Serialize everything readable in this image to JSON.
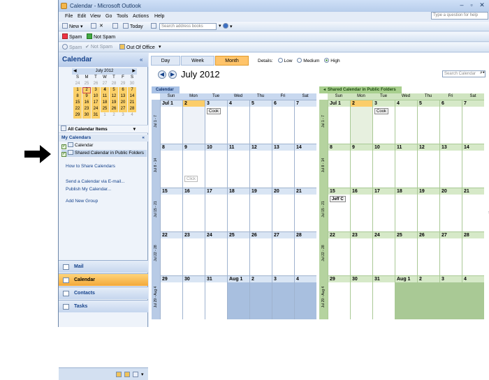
{
  "window": {
    "title": "Calendar - Microsoft Outlook"
  },
  "menu": [
    "File",
    "Edit",
    "View",
    "Go",
    "Tools",
    "Actions",
    "Help"
  ],
  "help_placeholder": "Type a question for help",
  "toolbar1": {
    "new": "New",
    "today": "Today",
    "address_placeholder": "Search address books"
  },
  "toolbar2": {
    "spam": "Spam",
    "not_spam": "Not Spam"
  },
  "toolbar3": {
    "spam": "Spam",
    "not_spam": "Not Spam",
    "out_of_office": "Out Of Office"
  },
  "nav": {
    "title": "Calendar",
    "mini_cal": {
      "month_label": "July 2012",
      "day_headers": [
        "S",
        "M",
        "T",
        "W",
        "T",
        "F",
        "S"
      ],
      "weeks": [
        [
          "24",
          "25",
          "26",
          "27",
          "28",
          "29",
          "30"
        ],
        [
          "1",
          "2",
          "3",
          "4",
          "5",
          "6",
          "7"
        ],
        [
          "8",
          "9",
          "10",
          "11",
          "12",
          "13",
          "14"
        ],
        [
          "15",
          "16",
          "17",
          "18",
          "19",
          "20",
          "21"
        ],
        [
          "22",
          "23",
          "24",
          "25",
          "26",
          "27",
          "28"
        ],
        [
          "29",
          "30",
          "31",
          "1",
          "2",
          "3",
          "4"
        ]
      ]
    },
    "all_calendar_items": "All Calendar Items",
    "my_calendars": "My Calendars",
    "calendars": [
      "Calendar",
      "Shared Calendar in Public Folders"
    ],
    "links": [
      "How to Share Calendars",
      "Send a Calendar via E-mail...",
      "Publish My Calendar...",
      "Add New Group"
    ],
    "buttons": [
      "Mail",
      "Calendar",
      "Contacts",
      "Tasks"
    ]
  },
  "main": {
    "tabs": [
      "Day",
      "Week",
      "Month"
    ],
    "details_label": "Details:",
    "details_options": [
      "Low",
      "Medium",
      "High"
    ],
    "month_title": "July 2012",
    "search_placeholder": "Search Calendar",
    "day_names": [
      "Sun",
      "Mon",
      "Tue",
      "Wed",
      "Thu",
      "Fri",
      "Sat"
    ],
    "weeks": [
      {
        "label": "Jul 1 - 7",
        "days": [
          "Jul 1",
          "2",
          "3",
          "4",
          "5",
          "6",
          "7"
        ]
      },
      {
        "label": "Jul 8 - 14",
        "days": [
          "8",
          "9",
          "10",
          "11",
          "12",
          "13",
          "14"
        ]
      },
      {
        "label": "Jul 15 - 21",
        "days": [
          "15",
          "16",
          "17",
          "18",
          "19",
          "20",
          "21"
        ]
      },
      {
        "label": "Jul 22 - 28",
        "days": [
          "22",
          "23",
          "24",
          "25",
          "26",
          "27",
          "28"
        ]
      },
      {
        "label": "Jul 29 - Aug 4",
        "days": [
          "29",
          "30",
          "31",
          "Aug 1",
          "2",
          "3",
          "4"
        ]
      }
    ],
    "calendar1": {
      "name": "Calendar",
      "appt_cook": "Cook",
      "appt_click": "Click"
    },
    "calendar2": {
      "name": "Shared Calendar in Public Folders",
      "appt_cook": "Cook",
      "appt_jeff": "Jeff C"
    }
  }
}
